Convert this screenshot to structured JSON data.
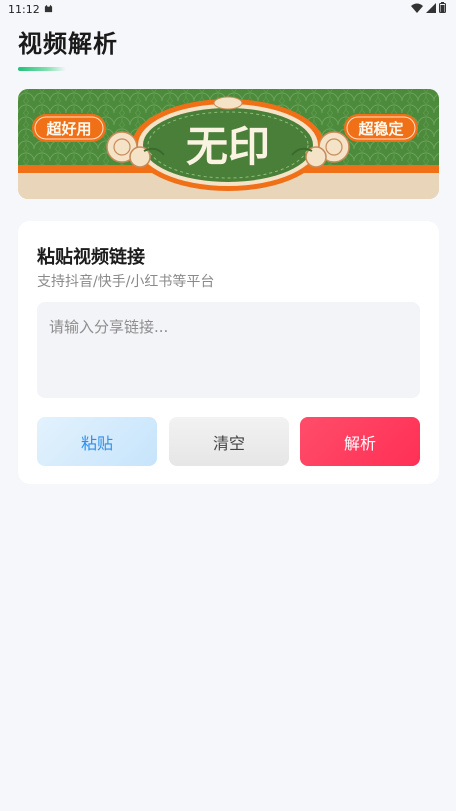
{
  "status_bar": {
    "time": "11:12"
  },
  "page": {
    "title": "视频解析"
  },
  "banner": {
    "left_badge": "超好用",
    "right_badge": "超稳定",
    "center_text": "无印"
  },
  "card": {
    "title": "粘贴视频链接",
    "subtitle": "支持抖音/快手/小红书等平台",
    "input_placeholder": "请输入分享链接...",
    "input_value": ""
  },
  "buttons": {
    "paste": "粘贴",
    "clear": "清空",
    "parse": "解析"
  },
  "colors": {
    "accent_green": "#22c07a",
    "paste_blue": "#2f8fe8",
    "parse_red": "#ff2f55",
    "banner_green": "#4e8a3e",
    "banner_orange": "#f07018"
  }
}
